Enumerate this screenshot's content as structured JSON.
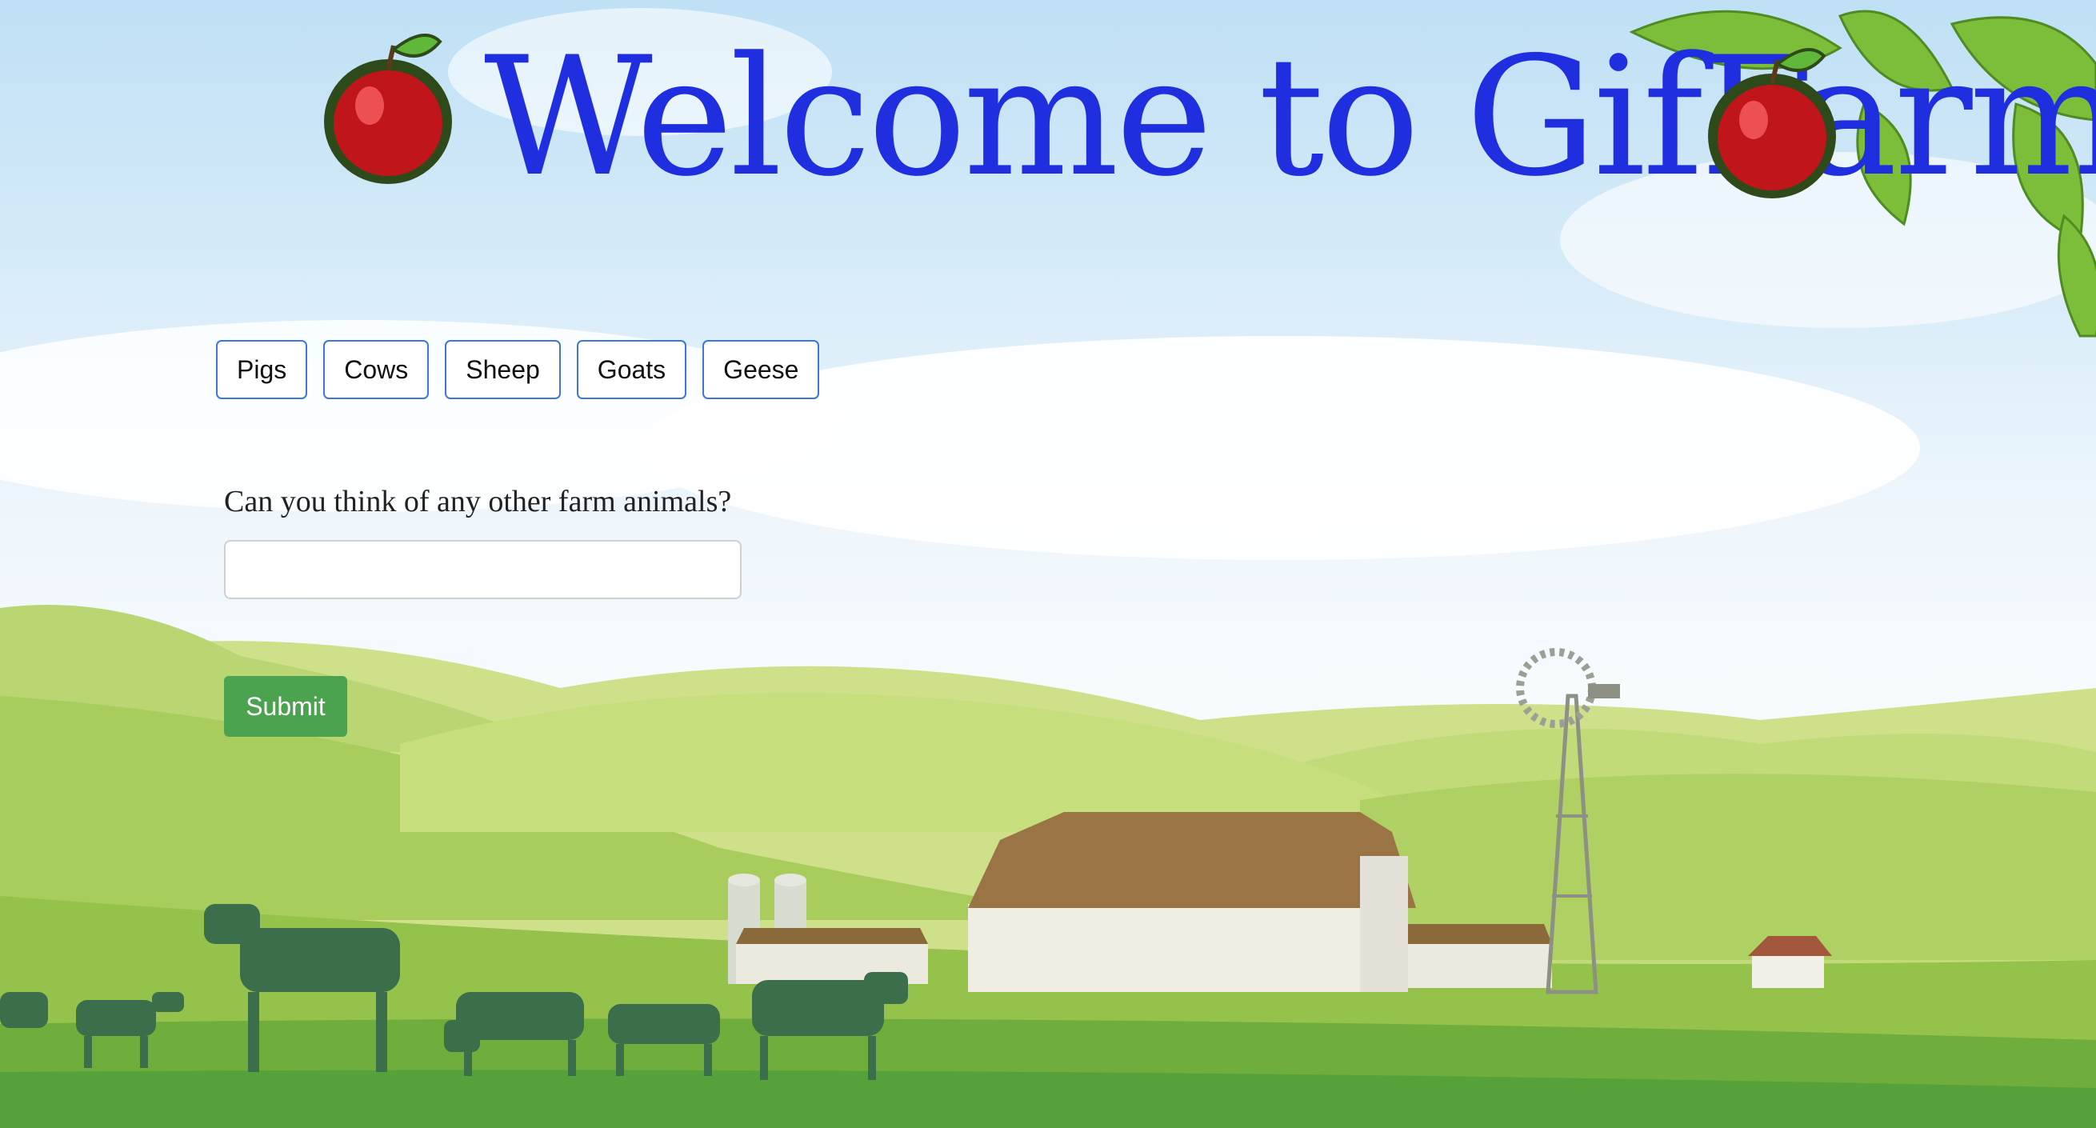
{
  "header": {
    "title": "Welcome to GifFarm!",
    "left_icon": "apple-icon",
    "right_icon": "apple-icon"
  },
  "nav": {
    "buttons": [
      "Pigs",
      "Cows",
      "Sheep",
      "Goats",
      "Geese"
    ]
  },
  "form": {
    "question": "Can you think of any other farm animals?",
    "input_value": "",
    "input_placeholder": "",
    "submit_label": "Submit"
  },
  "colors": {
    "title": "#1f2fe0",
    "button_border": "#3b78d8",
    "submit_bg": "#4ca34f",
    "apple_red": "#c0161b",
    "sky": "#cfe7f7",
    "grass": "#9cc64a"
  }
}
